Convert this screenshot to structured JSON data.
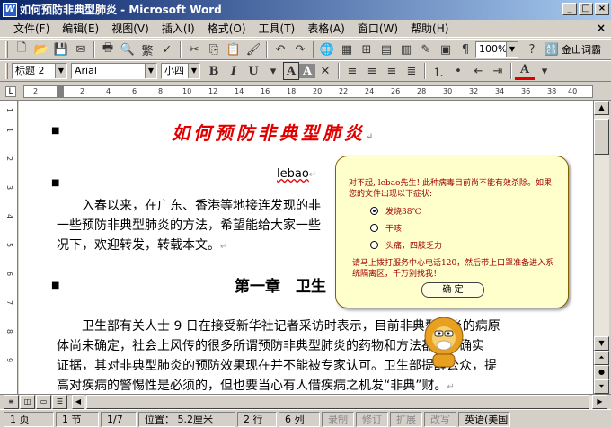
{
  "window": {
    "title": "如何预防非典型肺炎 - Microsoft Word"
  },
  "menu": [
    "文件(F)",
    "编辑(E)",
    "视图(V)",
    "插入(I)",
    "格式(O)",
    "工具(T)",
    "表格(A)",
    "窗口(W)",
    "帮助(H)"
  ],
  "menu_close": "×",
  "toolbar1": {
    "zoom": "100%",
    "kingsoft_label": "金山词霸"
  },
  "toolbar2": {
    "style": "标题 2",
    "font": "Arial",
    "size": "小四"
  },
  "ruler": [
    "2",
    "2",
    "4",
    "6",
    "8",
    "10",
    "12",
    "14",
    "16",
    "18",
    "20",
    "22",
    "24",
    "26",
    "28",
    "30",
    "32",
    "34",
    "36",
    "38",
    "40",
    "42",
    "44"
  ],
  "vruler": [
    "1",
    "1",
    "2",
    "3",
    "4",
    "5",
    "6",
    "7",
    "8",
    "9"
  ],
  "doc": {
    "title": "如何预防非典型肺炎",
    "author": "lebao",
    "para1_line1": "入春以来，在广东、香港等地接连发现的非",
    "para1_line2": "一些预防非典型肺炎的方法，希望能给大家一些",
    "para1_line3": "况下，欢迎转发，转载本文。",
    "chapter": "第一章　卫生",
    "para2_line1": "卫生部有关人士 9 日在接受新华社记者采访时表示，目前非典型肺炎的病原",
    "para2_line2": "体尚未确定，社会上风传的很多所谓预防非典型肺炎的药物和方法都没有确实",
    "para2_line3": "证据，其对非典型肺炎的预防效果现在并不能被专家认可。卫生部提醒公众，提",
    "para2_line4": "高对疾病的警惕性是必须的，但也要当心有人借疾病之机发“非典”财。"
  },
  "popup": {
    "message": "对不起, lebao先生! 此种病毒目前尚不能有效杀除。如果您的文件出现以下症状:",
    "options": [
      "发烧38℃",
      "干咳",
      "头痛，四肢乏力"
    ],
    "selected_option": 0,
    "footer": "请马上拨打服务中心电话120，然后带上口罩准备进入系统隔离区，千万别找我！",
    "ok": "确 定"
  },
  "status": {
    "page": "1 页",
    "section": "1 节",
    "pages": "1/7",
    "position": "位置： 5.2厘米",
    "line": "2 行",
    "column": "6 列",
    "rec": "录制",
    "trk": "修订",
    "ext": "扩展",
    "ovr": "改写",
    "lang": "英语(美国"
  }
}
